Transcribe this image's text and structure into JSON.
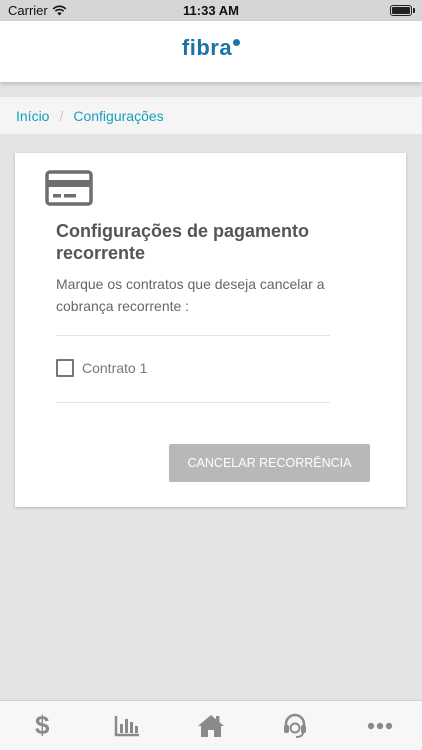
{
  "status_bar": {
    "carrier": "Carrier",
    "time": "11:33 AM"
  },
  "header": {
    "logo_text": "fibra",
    "brand_color": "#1e72a8"
  },
  "breadcrumb": {
    "items": [
      {
        "label": "Início"
      },
      {
        "label": "Configurações"
      }
    ],
    "separator": "/"
  },
  "card": {
    "icon": "credit-card-icon",
    "title": "Configurações de pagamento recorrente",
    "subtitle": "Marque os contratos que deseja cancelar a cobrança recorrente :",
    "contracts": [
      {
        "label": "Contrato 1",
        "checked": false
      }
    ],
    "cancel_button_label": "CANCELAR RECORRÊNCIA"
  },
  "tab_bar": {
    "tabs": [
      {
        "icon": "dollar-icon",
        "symbol": "$"
      },
      {
        "icon": "bar-chart-icon"
      },
      {
        "icon": "home-icon"
      },
      {
        "icon": "headset-icon"
      },
      {
        "icon": "more-icon"
      }
    ]
  }
}
